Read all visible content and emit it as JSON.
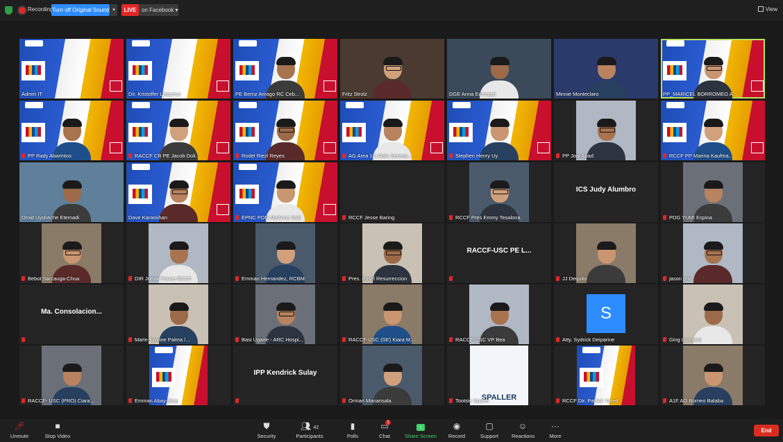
{
  "topbar": {
    "recording_label": "Recording",
    "sound_button": "Turn off Original Sound",
    "caret": "▾",
    "live_label": "LIVE",
    "live_target": "on Facebook ▾",
    "view_label": "View"
  },
  "tiles": [
    {
      "name": "Admin IT",
      "kind": "rotary",
      "muted": false
    },
    {
      "name": "Dir. Kristoffer Llegunas",
      "kind": "rotary",
      "muted": false
    },
    {
      "name": "PE Bernz Amago RC Ceb...",
      "kind": "rotary-person",
      "muted": false
    },
    {
      "name": "Fritz Strolz",
      "kind": "person",
      "muted": false
    },
    {
      "name": "DGE Anna Eumagat",
      "kind": "person",
      "muted": false
    },
    {
      "name": "Minnie Monteclaro",
      "kind": "person",
      "muted": false
    },
    {
      "name": "PP_MARICEL BORROMEO A...",
      "kind": "rotary-person",
      "muted": false
    },
    {
      "name": "PP Rady Abarintos",
      "kind": "rotary-person",
      "muted": true
    },
    {
      "name": "RACCF CB PE Jacob Doli...",
      "kind": "rotary-person",
      "muted": true
    },
    {
      "name": "Rodel Riezl Reyes",
      "kind": "rotary-person",
      "muted": true
    },
    {
      "name": "AG Area 1C Alain Senerp...",
      "kind": "rotary-person",
      "muted": true
    },
    {
      "name": "Stephen Henry Uy",
      "kind": "rotary-person",
      "muted": true
    },
    {
      "name": "PP Joal Abad",
      "kind": "portrait",
      "muted": true
    },
    {
      "name": "RCCF PP Marina Kaufma...",
      "kind": "rotary-person",
      "muted": true
    },
    {
      "name": "Omid Uysheche Etemadi",
      "kind": "person",
      "muted": false
    },
    {
      "name": "Dave Karamihan",
      "kind": "rotary-person",
      "muted": false
    },
    {
      "name": "EPNC PDG MeAnne Solo",
      "kind": "rotary-person",
      "muted": true
    },
    {
      "name": "RCCF Jesse Baring",
      "kind": "empty",
      "muted": true
    },
    {
      "name": "RCCF Pres Emmy Tesalona",
      "kind": "portrait",
      "muted": true
    },
    {
      "name": "",
      "kind": "bigname",
      "bigname": "ICS Judy Alumbro",
      "muted": false
    },
    {
      "name": "PDG YUMI Espina",
      "kind": "portrait",
      "muted": true
    },
    {
      "name": "Bebot Sarcauga-Chua",
      "kind": "portrait",
      "muted": true
    },
    {
      "name": "DIR Jomar Ponce RCCF",
      "kind": "portrait",
      "muted": true
    },
    {
      "name": "Emman Hernandez, RCBM",
      "kind": "portrait",
      "muted": true
    },
    {
      "name": "Pres. Essel Resurreccion",
      "kind": "portrait",
      "muted": true
    },
    {
      "name": "",
      "kind": "bigname",
      "bigname": "RACCF-USC PE L...",
      "muted": true
    },
    {
      "name": "JJ Dequito",
      "kind": "portrait",
      "muted": true
    },
    {
      "name": "jason ong",
      "kind": "portrait",
      "muted": true
    },
    {
      "name": "",
      "kind": "bigname",
      "bigname": "Ma. Consolacion...",
      "muted": true
    },
    {
      "name": "Marie Yvonne Palma /...",
      "kind": "portrait",
      "muted": true
    },
    {
      "name": "Basi Ugarte - ARC Hospi...",
      "kind": "portrait",
      "muted": true
    },
    {
      "name": "RACCF-USC (SE) Kiara M...",
      "kind": "portrait",
      "muted": true
    },
    {
      "name": "RACCF-USC VP Bea",
      "kind": "portrait",
      "muted": true
    },
    {
      "name": "Atty. Sydrick Deiparine",
      "kind": "initial",
      "initial": "S",
      "muted": true
    },
    {
      "name": "Ging Lomanta",
      "kind": "portrait",
      "muted": true
    },
    {
      "name": "RACCF- USC (PRO) Ciara...",
      "kind": "portrait",
      "muted": true
    },
    {
      "name": "Emman Abay-abay",
      "kind": "rotary-small",
      "muted": true
    },
    {
      "name": "",
      "kind": "bigname",
      "bigname": "IPP Kendrick Sulay",
      "muted": true
    },
    {
      "name": "Orman Manansala",
      "kind": "portrait",
      "muted": true
    },
    {
      "name": "Tootsie Spaller",
      "kind": "spaller",
      "muted": true
    },
    {
      "name": "RCCF Dir. Patrick Yared",
      "kind": "rotary-small",
      "muted": true
    },
    {
      "name": "A1F AG Romeo Balaba",
      "kind": "portrait",
      "muted": true
    }
  ],
  "toolbar": {
    "unmute": "Unmute",
    "stop_video": "Stop Video",
    "security": "Security",
    "participants": "Participants",
    "participants_count": "42",
    "polls": "Polls",
    "chat": "Chat",
    "chat_badge": "1",
    "share_screen": "Share Screen",
    "record": "Record",
    "support": "Support",
    "reactions": "Reactions",
    "more": "More",
    "end": "End"
  },
  "colors": {
    "accent_blue": "#2d8cff",
    "live_red": "#e02828",
    "share_green": "#3fd16a",
    "active_speaker": "#b7e05e"
  }
}
